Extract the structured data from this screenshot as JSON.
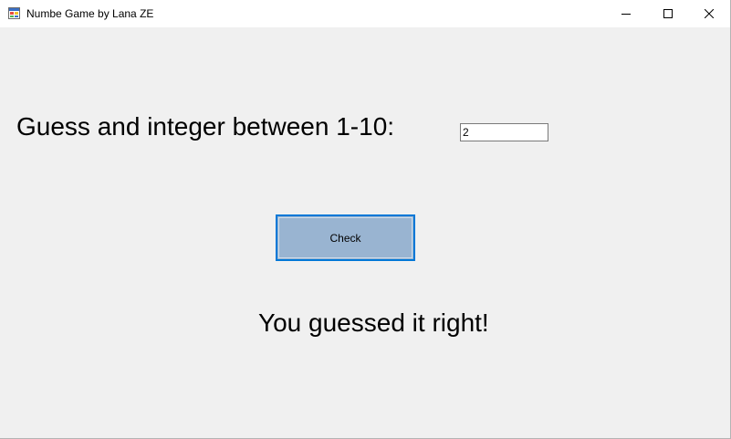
{
  "window": {
    "title": "Numbe Game by Lana ZE",
    "icon": "app-form-icon",
    "controls": [
      "minimize-icon",
      "maximize-icon",
      "close-icon"
    ]
  },
  "form": {
    "prompt": "Guess and integer between 1-10:",
    "input_value": "2",
    "check_button_label": "Check",
    "result": "You guessed it right!"
  },
  "colors": {
    "form_background": "#f0f0f0",
    "button_background": "#99b4d1",
    "button_focus_border": "#0078d7",
    "titlebar_background": "#ffffff"
  }
}
